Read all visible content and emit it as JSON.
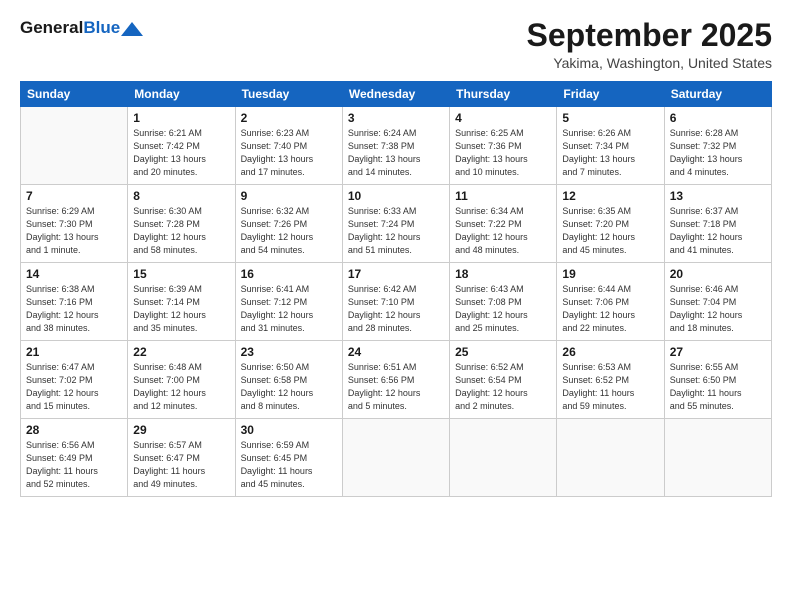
{
  "header": {
    "logo_general": "General",
    "logo_blue": "Blue",
    "month_title": "September 2025",
    "location": "Yakima, Washington, United States"
  },
  "days_of_week": [
    "Sunday",
    "Monday",
    "Tuesday",
    "Wednesday",
    "Thursday",
    "Friday",
    "Saturday"
  ],
  "weeks": [
    [
      {
        "day": "",
        "info": ""
      },
      {
        "day": "1",
        "info": "Sunrise: 6:21 AM\nSunset: 7:42 PM\nDaylight: 13 hours\nand 20 minutes."
      },
      {
        "day": "2",
        "info": "Sunrise: 6:23 AM\nSunset: 7:40 PM\nDaylight: 13 hours\nand 17 minutes."
      },
      {
        "day": "3",
        "info": "Sunrise: 6:24 AM\nSunset: 7:38 PM\nDaylight: 13 hours\nand 14 minutes."
      },
      {
        "day": "4",
        "info": "Sunrise: 6:25 AM\nSunset: 7:36 PM\nDaylight: 13 hours\nand 10 minutes."
      },
      {
        "day": "5",
        "info": "Sunrise: 6:26 AM\nSunset: 7:34 PM\nDaylight: 13 hours\nand 7 minutes."
      },
      {
        "day": "6",
        "info": "Sunrise: 6:28 AM\nSunset: 7:32 PM\nDaylight: 13 hours\nand 4 minutes."
      }
    ],
    [
      {
        "day": "7",
        "info": "Sunrise: 6:29 AM\nSunset: 7:30 PM\nDaylight: 13 hours\nand 1 minute."
      },
      {
        "day": "8",
        "info": "Sunrise: 6:30 AM\nSunset: 7:28 PM\nDaylight: 12 hours\nand 58 minutes."
      },
      {
        "day": "9",
        "info": "Sunrise: 6:32 AM\nSunset: 7:26 PM\nDaylight: 12 hours\nand 54 minutes."
      },
      {
        "day": "10",
        "info": "Sunrise: 6:33 AM\nSunset: 7:24 PM\nDaylight: 12 hours\nand 51 minutes."
      },
      {
        "day": "11",
        "info": "Sunrise: 6:34 AM\nSunset: 7:22 PM\nDaylight: 12 hours\nand 48 minutes."
      },
      {
        "day": "12",
        "info": "Sunrise: 6:35 AM\nSunset: 7:20 PM\nDaylight: 12 hours\nand 45 minutes."
      },
      {
        "day": "13",
        "info": "Sunrise: 6:37 AM\nSunset: 7:18 PM\nDaylight: 12 hours\nand 41 minutes."
      }
    ],
    [
      {
        "day": "14",
        "info": "Sunrise: 6:38 AM\nSunset: 7:16 PM\nDaylight: 12 hours\nand 38 minutes."
      },
      {
        "day": "15",
        "info": "Sunrise: 6:39 AM\nSunset: 7:14 PM\nDaylight: 12 hours\nand 35 minutes."
      },
      {
        "day": "16",
        "info": "Sunrise: 6:41 AM\nSunset: 7:12 PM\nDaylight: 12 hours\nand 31 minutes."
      },
      {
        "day": "17",
        "info": "Sunrise: 6:42 AM\nSunset: 7:10 PM\nDaylight: 12 hours\nand 28 minutes."
      },
      {
        "day": "18",
        "info": "Sunrise: 6:43 AM\nSunset: 7:08 PM\nDaylight: 12 hours\nand 25 minutes."
      },
      {
        "day": "19",
        "info": "Sunrise: 6:44 AM\nSunset: 7:06 PM\nDaylight: 12 hours\nand 22 minutes."
      },
      {
        "day": "20",
        "info": "Sunrise: 6:46 AM\nSunset: 7:04 PM\nDaylight: 12 hours\nand 18 minutes."
      }
    ],
    [
      {
        "day": "21",
        "info": "Sunrise: 6:47 AM\nSunset: 7:02 PM\nDaylight: 12 hours\nand 15 minutes."
      },
      {
        "day": "22",
        "info": "Sunrise: 6:48 AM\nSunset: 7:00 PM\nDaylight: 12 hours\nand 12 minutes."
      },
      {
        "day": "23",
        "info": "Sunrise: 6:50 AM\nSunset: 6:58 PM\nDaylight: 12 hours\nand 8 minutes."
      },
      {
        "day": "24",
        "info": "Sunrise: 6:51 AM\nSunset: 6:56 PM\nDaylight: 12 hours\nand 5 minutes."
      },
      {
        "day": "25",
        "info": "Sunrise: 6:52 AM\nSunset: 6:54 PM\nDaylight: 12 hours\nand 2 minutes."
      },
      {
        "day": "26",
        "info": "Sunrise: 6:53 AM\nSunset: 6:52 PM\nDaylight: 11 hours\nand 59 minutes."
      },
      {
        "day": "27",
        "info": "Sunrise: 6:55 AM\nSunset: 6:50 PM\nDaylight: 11 hours\nand 55 minutes."
      }
    ],
    [
      {
        "day": "28",
        "info": "Sunrise: 6:56 AM\nSunset: 6:49 PM\nDaylight: 11 hours\nand 52 minutes."
      },
      {
        "day": "29",
        "info": "Sunrise: 6:57 AM\nSunset: 6:47 PM\nDaylight: 11 hours\nand 49 minutes."
      },
      {
        "day": "30",
        "info": "Sunrise: 6:59 AM\nSunset: 6:45 PM\nDaylight: 11 hours\nand 45 minutes."
      },
      {
        "day": "",
        "info": ""
      },
      {
        "day": "",
        "info": ""
      },
      {
        "day": "",
        "info": ""
      },
      {
        "day": "",
        "info": ""
      }
    ]
  ]
}
